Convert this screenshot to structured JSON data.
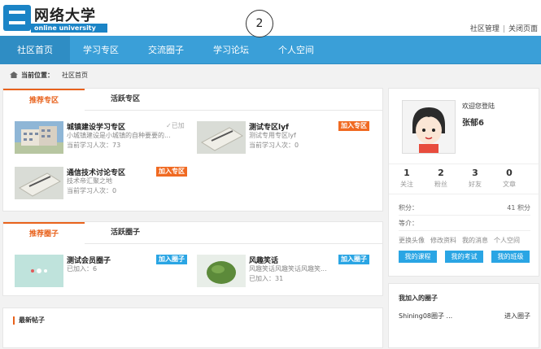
{
  "header": {
    "logo_title": "网络大学",
    "logo_sub": "online university",
    "toplinks": [
      "社区管理",
      "关闭页面"
    ],
    "marker": "2"
  },
  "nav": {
    "items": [
      "社区首页",
      "学习专区",
      "交流圈子",
      "学习论坛",
      "个人空间"
    ],
    "active_index": 0
  },
  "breadcrumb": {
    "label": "当前位置：",
    "current": "社区首页"
  },
  "zones": {
    "tabs": [
      "推荐专区",
      "活跃专区"
    ],
    "active_tab": 0,
    "cards": [
      {
        "title": "城镇建设学习专区",
        "desc": "小城镇建设是小城镇的自种要要的...",
        "count": "当前学习人次：73",
        "action": "已加",
        "action_type": "joined"
      },
      {
        "title": "测试专区lyf",
        "desc": "测试专用专区lyf",
        "count": "当前学习人次：0",
        "action": "加入专区",
        "action_type": "join"
      },
      {
        "title": "通信技术讨论专区",
        "desc": "技术帝汇聚之地",
        "count": "当前学习人次：0",
        "action": "加入专区",
        "action_type": "join"
      }
    ]
  },
  "circles": {
    "tabs": [
      "推荐圈子",
      "活跃圈子"
    ],
    "active_tab": 0,
    "cards": [
      {
        "title": "测试会员圈子",
        "desc": "",
        "count": "已加入：6",
        "action": "加入圈子"
      },
      {
        "title": "风趣笑话",
        "desc": "风趣笑话风趣笑话风趣笑...",
        "count": "已加入：31",
        "action": "加入圈子"
      }
    ]
  },
  "news": {
    "title": "最新帖子"
  },
  "profile": {
    "welcome": "欢迎您登陆",
    "name": "张郁6",
    "stats": [
      {
        "n": "1",
        "l": "关注"
      },
      {
        "n": "2",
        "l": "粉丝"
      },
      {
        "n": "3",
        "l": "好友"
      },
      {
        "n": "0",
        "l": "文章"
      }
    ],
    "points_label": "积分：",
    "points_value": "41 积分",
    "rating_label": "等介：",
    "links": [
      "更换头像",
      "修改资料",
      "我的消息",
      "个人空间"
    ],
    "buttons": [
      "我的课程",
      "我的考试",
      "我的班级"
    ]
  },
  "my_circles": {
    "title": "我加入的圈子",
    "item_name": "Shining08圈子 ...",
    "item_action": "进入圈子"
  },
  "colors": {
    "nav": "#3a9fd8",
    "accent": "#e8621c",
    "button_blue": "#2aa5e4"
  }
}
